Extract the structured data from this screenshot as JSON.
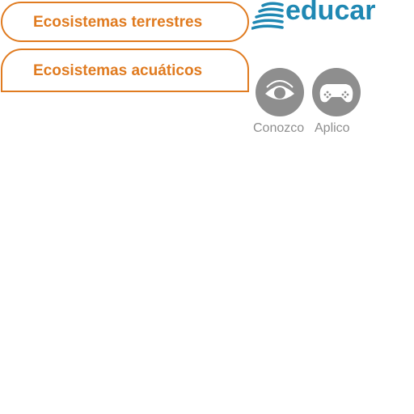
{
  "menu": {
    "items": [
      {
        "label": "Ecosistemas terrestres"
      },
      {
        "label": "Ecosistemas acuáticos"
      }
    ]
  },
  "brand": {
    "logo_text": "educar",
    "logo_icon": "educar-logo-icon",
    "color": "#1f88b3"
  },
  "modes": {
    "conozco": {
      "label": "Conozco",
      "icon": "eye-icon"
    },
    "aplico": {
      "label": "Aplico",
      "icon": "gamepad-icon"
    }
  },
  "colors": {
    "accent": "#e07b20",
    "mode_gray": "#8e8e8e"
  }
}
